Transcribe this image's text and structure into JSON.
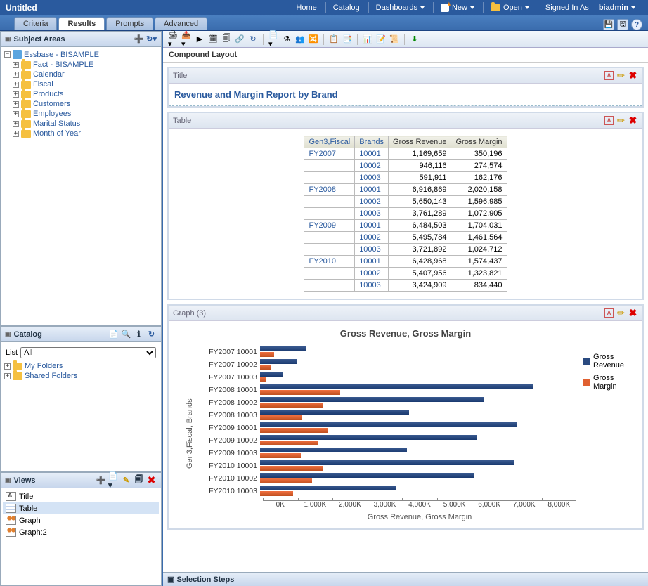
{
  "header": {
    "title": "Untitled",
    "menu": [
      "Home",
      "Catalog",
      "Dashboards",
      "New",
      "Open"
    ],
    "signed_in_label": "Signed In As",
    "signed_in_user": "biadmin"
  },
  "tabs": {
    "items": [
      "Criteria",
      "Results",
      "Prompts",
      "Advanced"
    ],
    "active_index": 1
  },
  "subject_areas": {
    "title": "Subject Areas",
    "root": "Essbase - BISAMPLE",
    "children": [
      "Fact - BISAMPLE",
      "Calendar",
      "Fiscal",
      "Products",
      "Customers",
      "Employees",
      "Marital Status",
      "Month of Year"
    ]
  },
  "catalog": {
    "title": "Catalog",
    "list_label": "List",
    "list_value": "All",
    "folders": [
      "My Folders",
      "Shared Folders"
    ]
  },
  "views": {
    "title": "Views",
    "items": [
      "Title",
      "Table",
      "Graph",
      "Graph:2"
    ],
    "selected_index": 1
  },
  "compound_layout_label": "Compound Layout",
  "title_view": {
    "header": "Title",
    "text": "Revenue and Margin Report by Brand"
  },
  "table_view": {
    "header": "Table",
    "columns": [
      "Gen3,Fiscal",
      "Brands",
      "Gross Revenue",
      "Gross Margin"
    ],
    "rows": [
      {
        "fiscal": "FY2007",
        "brand": "10001",
        "rev": "1,169,659",
        "mar": "350,196"
      },
      {
        "fiscal": "",
        "brand": "10002",
        "rev": "946,116",
        "mar": "274,574"
      },
      {
        "fiscal": "",
        "brand": "10003",
        "rev": "591,911",
        "mar": "162,176"
      },
      {
        "fiscal": "FY2008",
        "brand": "10001",
        "rev": "6,916,869",
        "mar": "2,020,158"
      },
      {
        "fiscal": "",
        "brand": "10002",
        "rev": "5,650,143",
        "mar": "1,596,985"
      },
      {
        "fiscal": "",
        "brand": "10003",
        "rev": "3,761,289",
        "mar": "1,072,905"
      },
      {
        "fiscal": "FY2009",
        "brand": "10001",
        "rev": "6,484,503",
        "mar": "1,704,031"
      },
      {
        "fiscal": "",
        "brand": "10002",
        "rev": "5,495,784",
        "mar": "1,461,564"
      },
      {
        "fiscal": "",
        "brand": "10003",
        "rev": "3,721,892",
        "mar": "1,024,712"
      },
      {
        "fiscal": "FY2010",
        "brand": "10001",
        "rev": "6,428,968",
        "mar": "1,574,437"
      },
      {
        "fiscal": "",
        "brand": "10002",
        "rev": "5,407,956",
        "mar": "1,323,821"
      },
      {
        "fiscal": "",
        "brand": "10003",
        "rev": "3,424,909",
        "mar": "834,440"
      }
    ]
  },
  "graph_view": {
    "header": "Graph (3)",
    "title": "Gross Revenue, Gross Margin",
    "y_label": "Gen3,Fiscal, Brands",
    "x_label": "Gross Revenue, Gross Margin",
    "x_ticks": [
      "0K",
      "1,000K",
      "2,000K",
      "3,000K",
      "4,000K",
      "5,000K",
      "6,000K",
      "7,000K",
      "8,000K"
    ],
    "legend": [
      "Gross Revenue",
      "Gross Margin"
    ]
  },
  "chart_data": {
    "type": "bar",
    "orientation": "horizontal",
    "categories": [
      "FY2007 10001",
      "FY2007 10002",
      "FY2007 10003",
      "FY2008 10001",
      "FY2008 10002",
      "FY2008 10003",
      "FY2009 10001",
      "FY2009 10002",
      "FY2009 10003",
      "FY2010 10001",
      "FY2010 10002",
      "FY2010 10003"
    ],
    "series": [
      {
        "name": "Gross Revenue",
        "color": "#2a4a80",
        "values": [
          1169659,
          946116,
          591911,
          6916869,
          5650143,
          3761289,
          6484503,
          5495784,
          3721892,
          6428968,
          5407956,
          3424909
        ]
      },
      {
        "name": "Gross Margin",
        "color": "#e06030",
        "values": [
          350196,
          274574,
          162176,
          2020158,
          1596985,
          1072905,
          1704031,
          1461564,
          1024712,
          1574437,
          1323821,
          834440
        ]
      }
    ],
    "xlim": [
      0,
      8000000
    ],
    "title": "Gross Revenue, Gross Margin",
    "xlabel": "Gross Revenue, Gross Margin",
    "ylabel": "Gen3,Fiscal, Brands"
  },
  "selection_steps_label": "Selection Steps"
}
